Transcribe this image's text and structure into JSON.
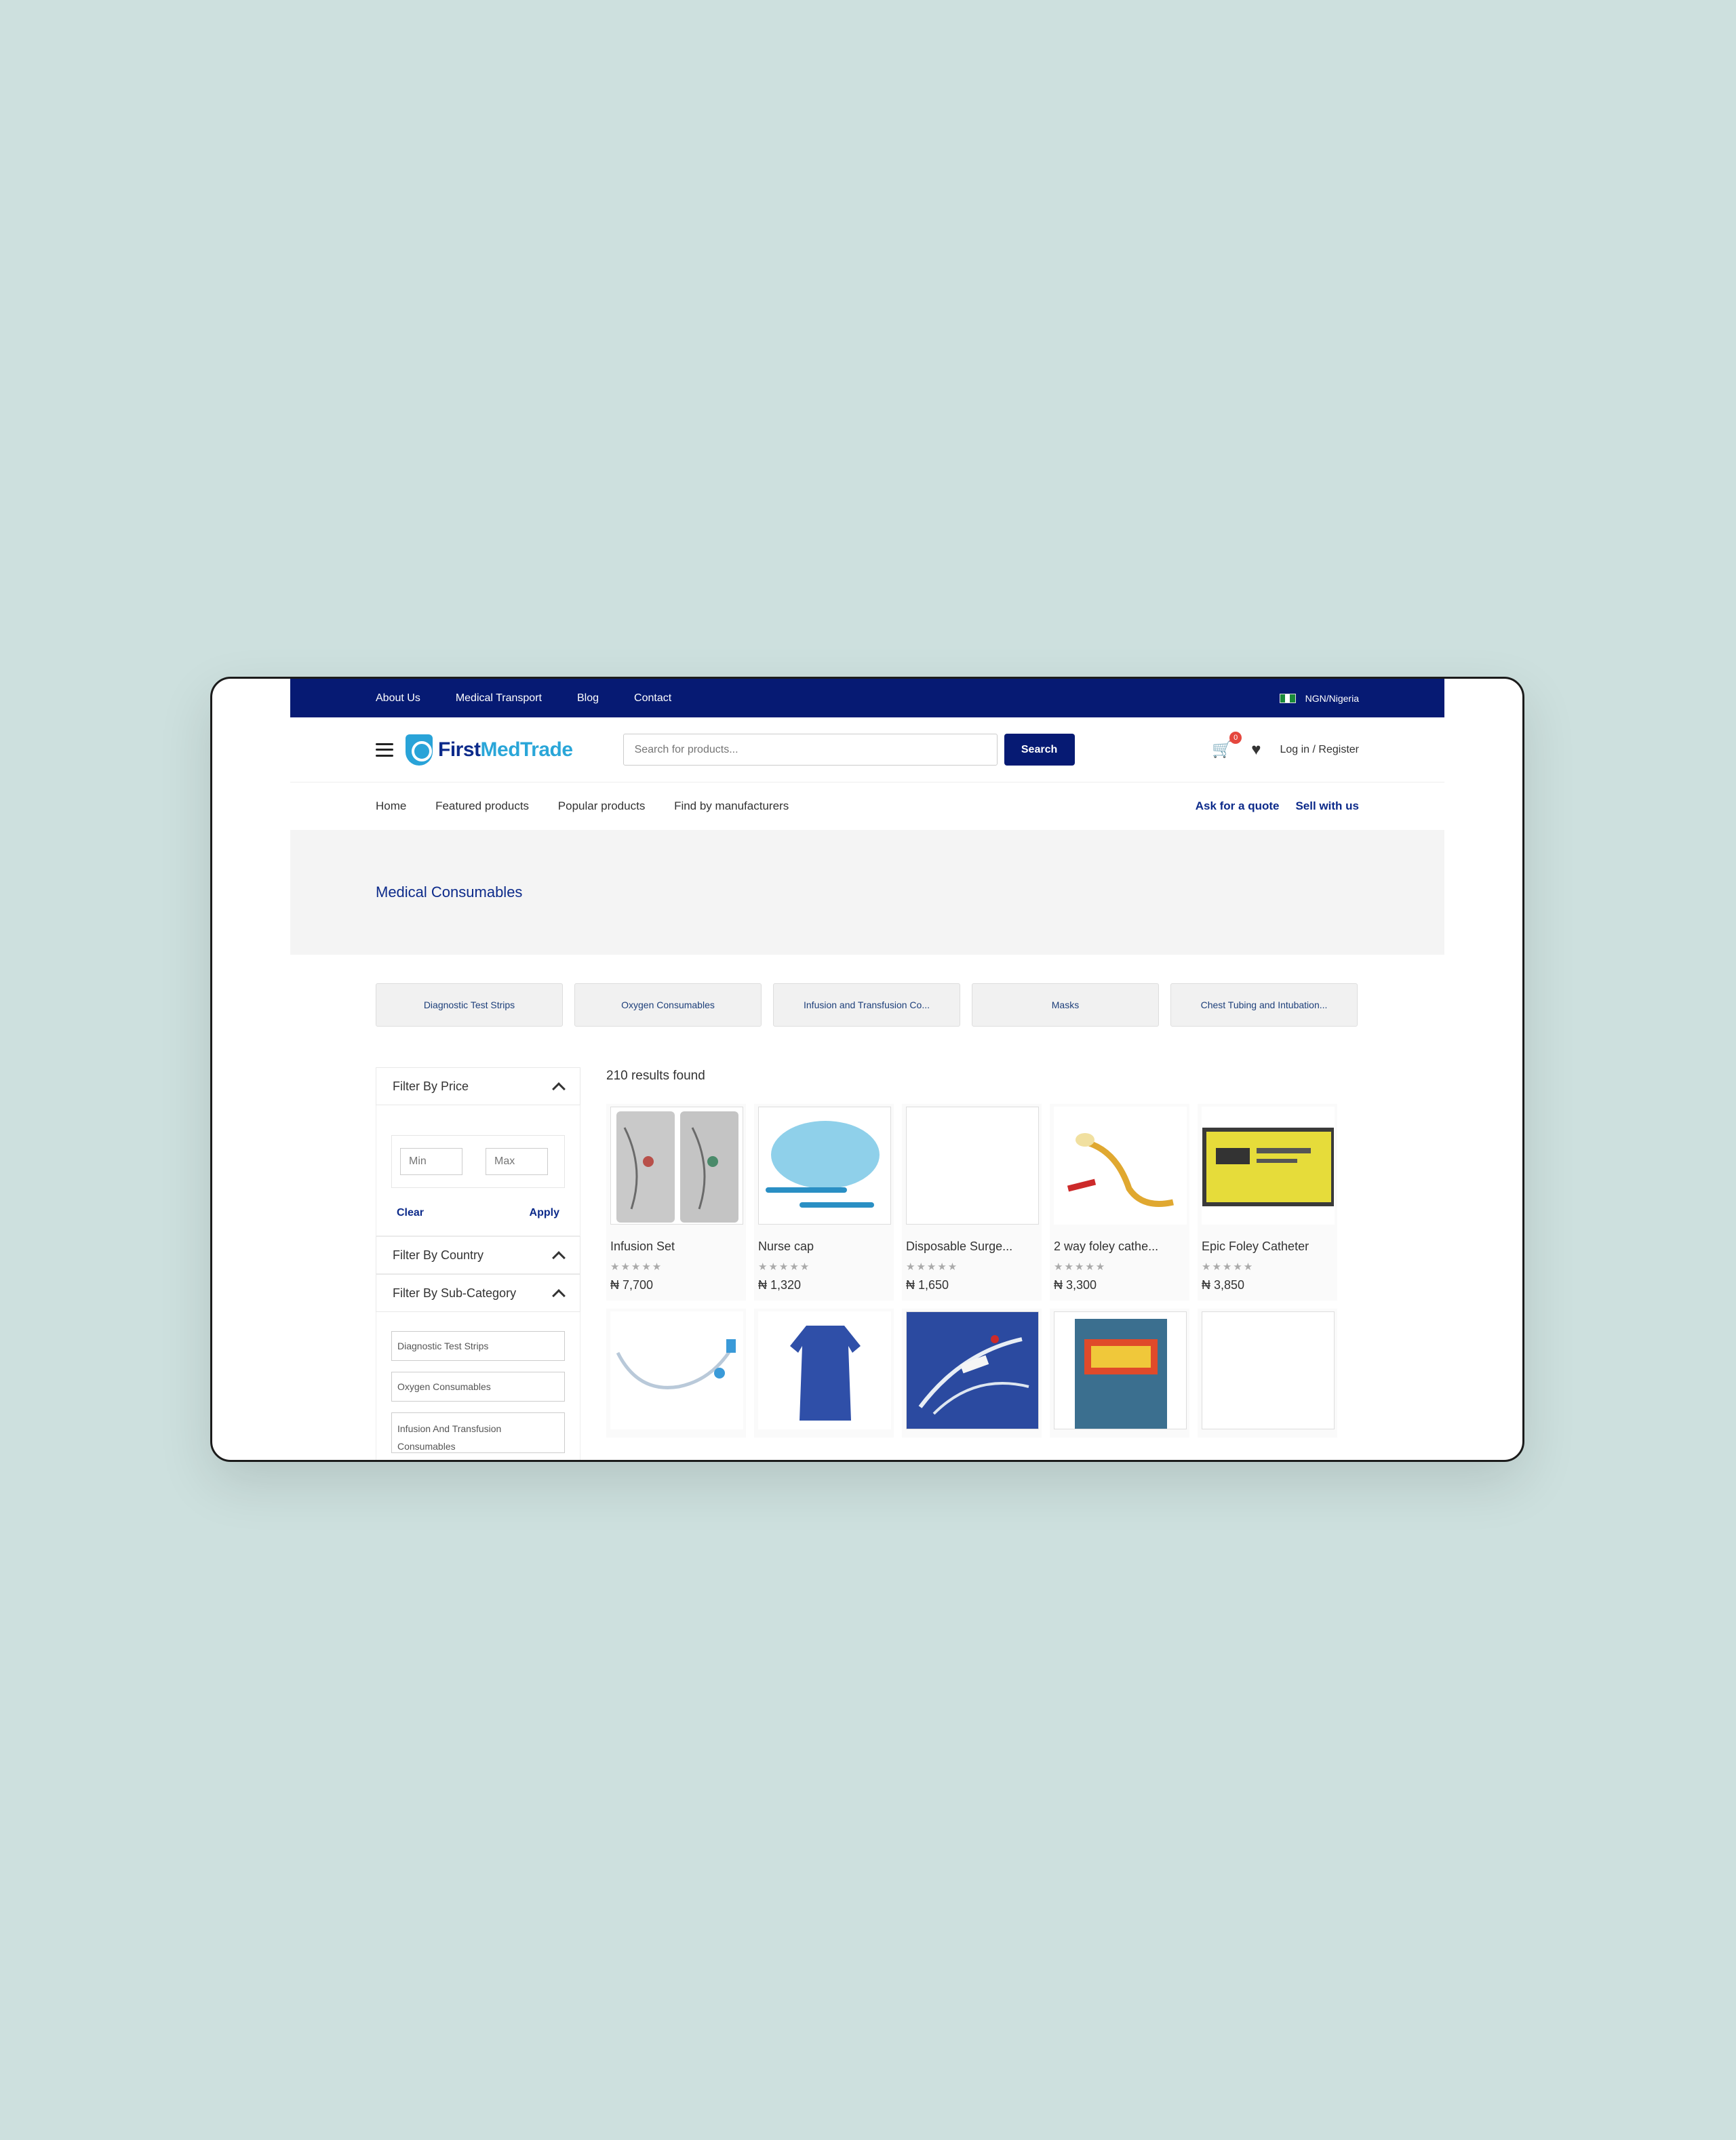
{
  "topbar": {
    "links": [
      "About Us",
      "Medical Transport",
      "Blog",
      "Contact"
    ],
    "locale": "NGN/Nigeria"
  },
  "header": {
    "logo_first": "First",
    "logo_med": "MedTrade",
    "search_placeholder": "Search for products...",
    "search_button": "Search",
    "cart_count": "0",
    "login_label": "Log in / Register"
  },
  "nav": {
    "links": [
      "Home",
      "Featured products",
      "Popular products",
      "Find by manufacturers"
    ],
    "ask_quote": "Ask for a quote",
    "sell": "Sell with us"
  },
  "banner": {
    "title": "Medical Consumables"
  },
  "categories": [
    "Diagnostic Test Strips",
    "Oxygen Consumables",
    "Infusion and Transfusion Co...",
    "Masks",
    "Chest Tubing and Intubation..."
  ],
  "filters": {
    "price_title": "Filter By Price",
    "min_placeholder": "Min",
    "max_placeholder": "Max",
    "clear": "Clear",
    "apply": "Apply",
    "country_title": "Filter By Country",
    "subcategory_title": "Filter By Sub-Category",
    "subcategories": [
      "Diagnostic Test Strips",
      "Oxygen Consumables",
      "Infusion And Transfusion Consumables"
    ]
  },
  "results": {
    "count_text": "210 results found"
  },
  "products": [
    {
      "name": "Infusion Set",
      "price": "₦ 7,700",
      "rating": "★★★★★"
    },
    {
      "name": "Nurse cap",
      "price": "₦ 1,320",
      "rating": "★★★★★"
    },
    {
      "name": "Disposable Surge...",
      "price": "₦ 1,650",
      "rating": "★★★★★"
    },
    {
      "name": "2 way foley cathe...",
      "price": "₦ 3,300",
      "rating": "★★★★★"
    },
    {
      "name": "Epic Foley Catheter",
      "price": "₦ 3,850",
      "rating": "★★★★★"
    }
  ],
  "colors": {
    "primary": "#061a73",
    "accent": "#2aa6d8",
    "background": "#cde0de"
  }
}
